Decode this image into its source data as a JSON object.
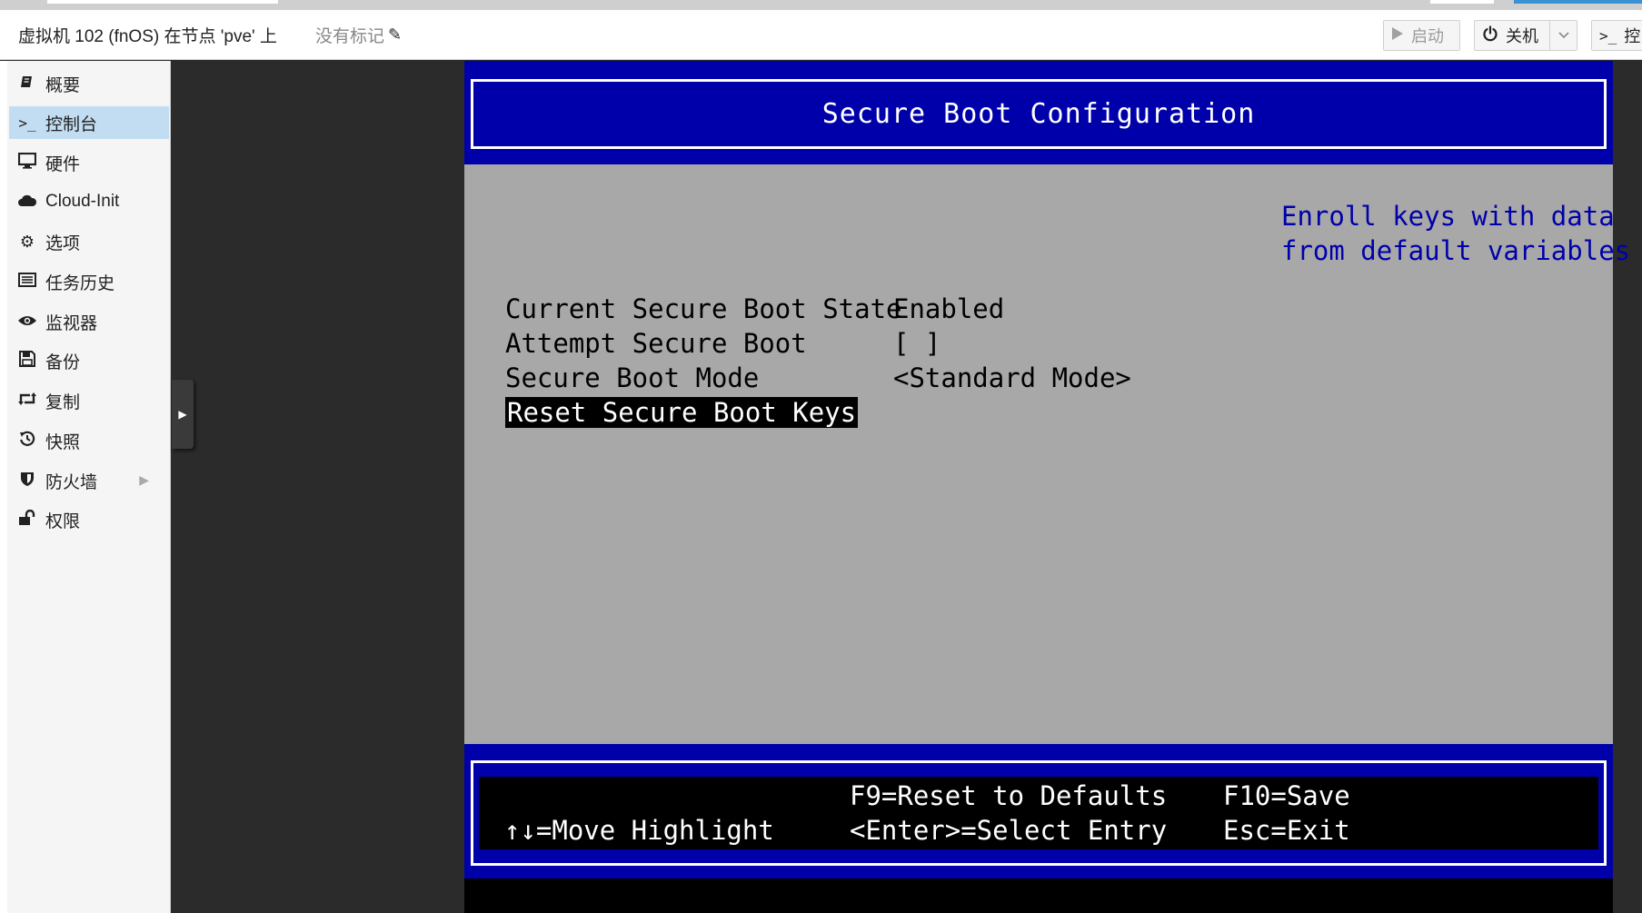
{
  "header": {
    "vm_title": "虚拟机 102 (fnOS) 在节点 'pve' 上",
    "tags_label": "没有标记",
    "buttons": {
      "start": "启动",
      "shutdown": "关机",
      "console": "控"
    }
  },
  "sidebar": {
    "items": [
      {
        "label": "概要",
        "icon": "book-icon"
      },
      {
        "label": "控制台",
        "icon": "terminal-icon"
      },
      {
        "label": "硬件",
        "icon": "monitor-icon"
      },
      {
        "label": "Cloud-Init",
        "icon": "cloud-icon"
      },
      {
        "label": "选项",
        "icon": "gear-icon"
      },
      {
        "label": "任务历史",
        "icon": "list-icon"
      },
      {
        "label": "监视器",
        "icon": "eye-icon"
      },
      {
        "label": "备份",
        "icon": "floppy-icon"
      },
      {
        "label": "复制",
        "icon": "retweet-icon"
      },
      {
        "label": "快照",
        "icon": "history-icon"
      },
      {
        "label": "防火墙",
        "icon": "shield-icon"
      },
      {
        "label": "权限",
        "icon": "unlock-icon"
      }
    ],
    "active_index": 1
  },
  "bios": {
    "title": "Secure Boot Configuration",
    "rows": [
      {
        "label": "Current Secure Boot State",
        "value": "Enabled"
      },
      {
        "label": "Attempt Secure Boot",
        "value": "[ ]"
      },
      {
        "label": "Secure Boot Mode",
        "value": "<Standard Mode>"
      },
      {
        "label": "Reset Secure Boot Keys",
        "value": ""
      }
    ],
    "highlighted_row": 3,
    "help_line1": "Enroll keys with data",
    "help_line2": "from default variables",
    "footer": {
      "move": "↑↓=Move Highlight",
      "f9": "F9=Reset to Defaults",
      "enter": "<Enter>=Select Entry",
      "f10": "F10=Save",
      "esc": "Esc=Exit"
    },
    "colors": {
      "blue": "#0000aa",
      "gray": "#a8a8a8",
      "white": "#ffffff",
      "black": "#000000"
    }
  }
}
